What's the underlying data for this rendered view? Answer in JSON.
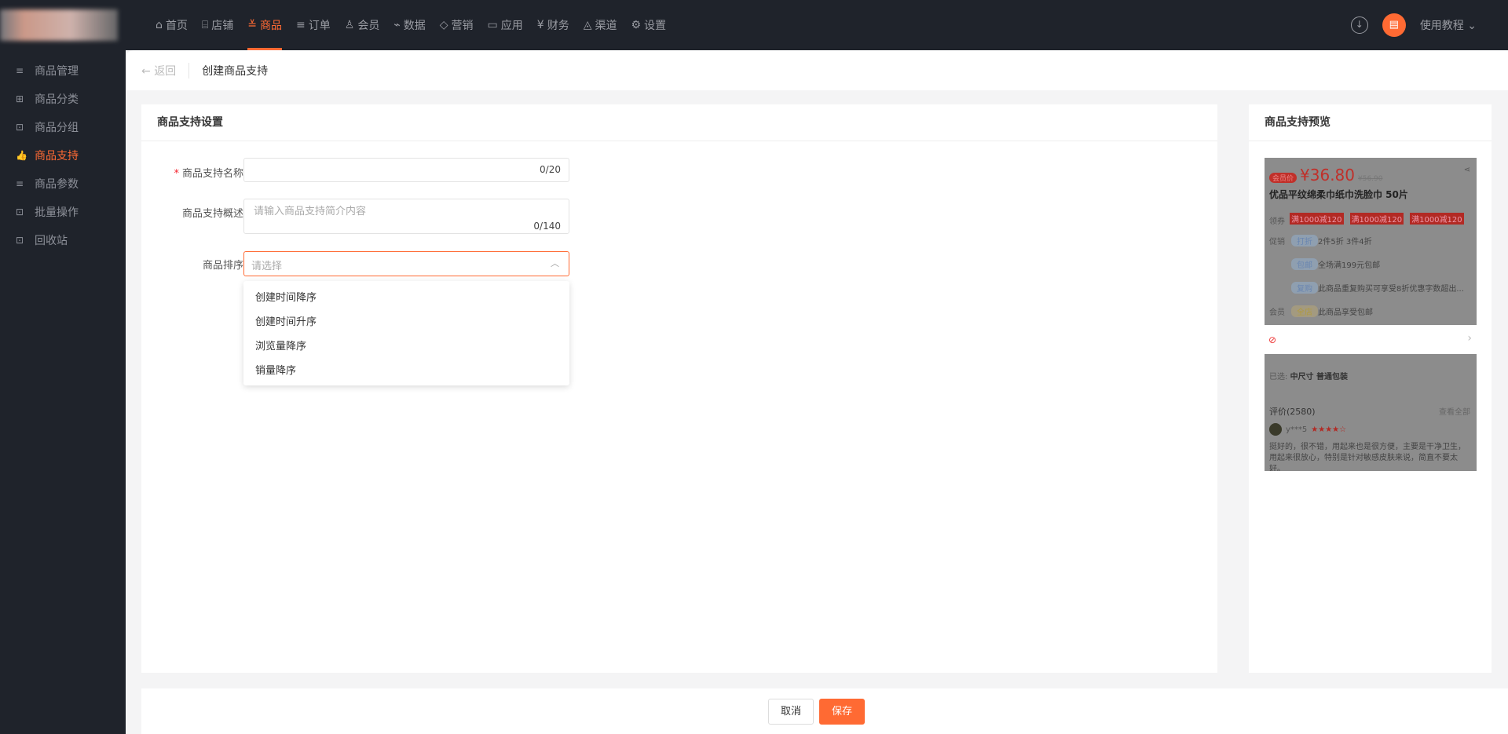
{
  "nav": {
    "items": [
      {
        "label": "首页",
        "icon": "home-icon"
      },
      {
        "label": "店铺",
        "icon": "shop-icon"
      },
      {
        "label": "商品",
        "icon": "goods-icon"
      },
      {
        "label": "订单",
        "icon": "order-icon"
      },
      {
        "label": "会员",
        "icon": "user-icon"
      },
      {
        "label": "数据",
        "icon": "chart-icon"
      },
      {
        "label": "营销",
        "icon": "tag-icon"
      },
      {
        "label": "应用",
        "icon": "app-icon"
      },
      {
        "label": "财务",
        "icon": "finance-icon"
      },
      {
        "label": "渠道",
        "icon": "channel-icon"
      },
      {
        "label": "设置",
        "icon": "gear-icon"
      }
    ],
    "active": "商品",
    "help": "使用教程"
  },
  "sidebar": {
    "items": [
      {
        "label": "商品管理"
      },
      {
        "label": "商品分类"
      },
      {
        "label": "商品分组"
      },
      {
        "label": "商品支持"
      },
      {
        "label": "商品参数"
      },
      {
        "label": "批量操作"
      },
      {
        "label": "回收站"
      }
    ]
  },
  "breadcrumb": {
    "back": "返回",
    "title": "创建商品支持"
  },
  "form": {
    "title": "商品支持设置",
    "name_label": "商品支持名称",
    "name_count": "0/20",
    "desc_label": "商品支持概述",
    "desc_placeholder": "请输入商品支持简介内容",
    "desc_count": "0/140",
    "sort_label": "商品排序",
    "sort_placeholder": "请选择",
    "sort_options": [
      "创建时间降序",
      "创建时间升序",
      "浏览量降序",
      "销量降序"
    ]
  },
  "preview": {
    "title": "商品支持预览",
    "badge": "会员价",
    "price": "¥36.80",
    "old_price": "¥56.90",
    "product": "优品平纹绵柔巾纸巾洗脸巾 50片",
    "coupon_label": "领券",
    "coupon": "满1000减120",
    "promo_label": "促销",
    "tag_discount": "打折",
    "discount_text": "2件5折  3件4折",
    "tag_ship": "包邮",
    "ship_text": "全场满199元包邮",
    "tag_rebuy": "复购",
    "rebuy_text": "此商品重复购买可享受8折优惠字数超出...",
    "member_label": "会员",
    "tag_member": "全店",
    "member_text": "此商品享受包邮",
    "selected_label": "已选:",
    "selected": "中尺寸 普通包装",
    "review_title": "评价(2580)",
    "view_all": "查看全部",
    "reviewer": "y***5",
    "stars": 4,
    "review": "挺好的，很不错，用起来也是很方便，主要是干净卫生，用起来很放心，特别是针对敏感皮肤来说，简直不要太好。"
  },
  "footer": {
    "cancel": "取消",
    "save": "保存"
  },
  "colors": {
    "accent": "#ff6a33",
    "nav_bg": "#1f232b"
  }
}
